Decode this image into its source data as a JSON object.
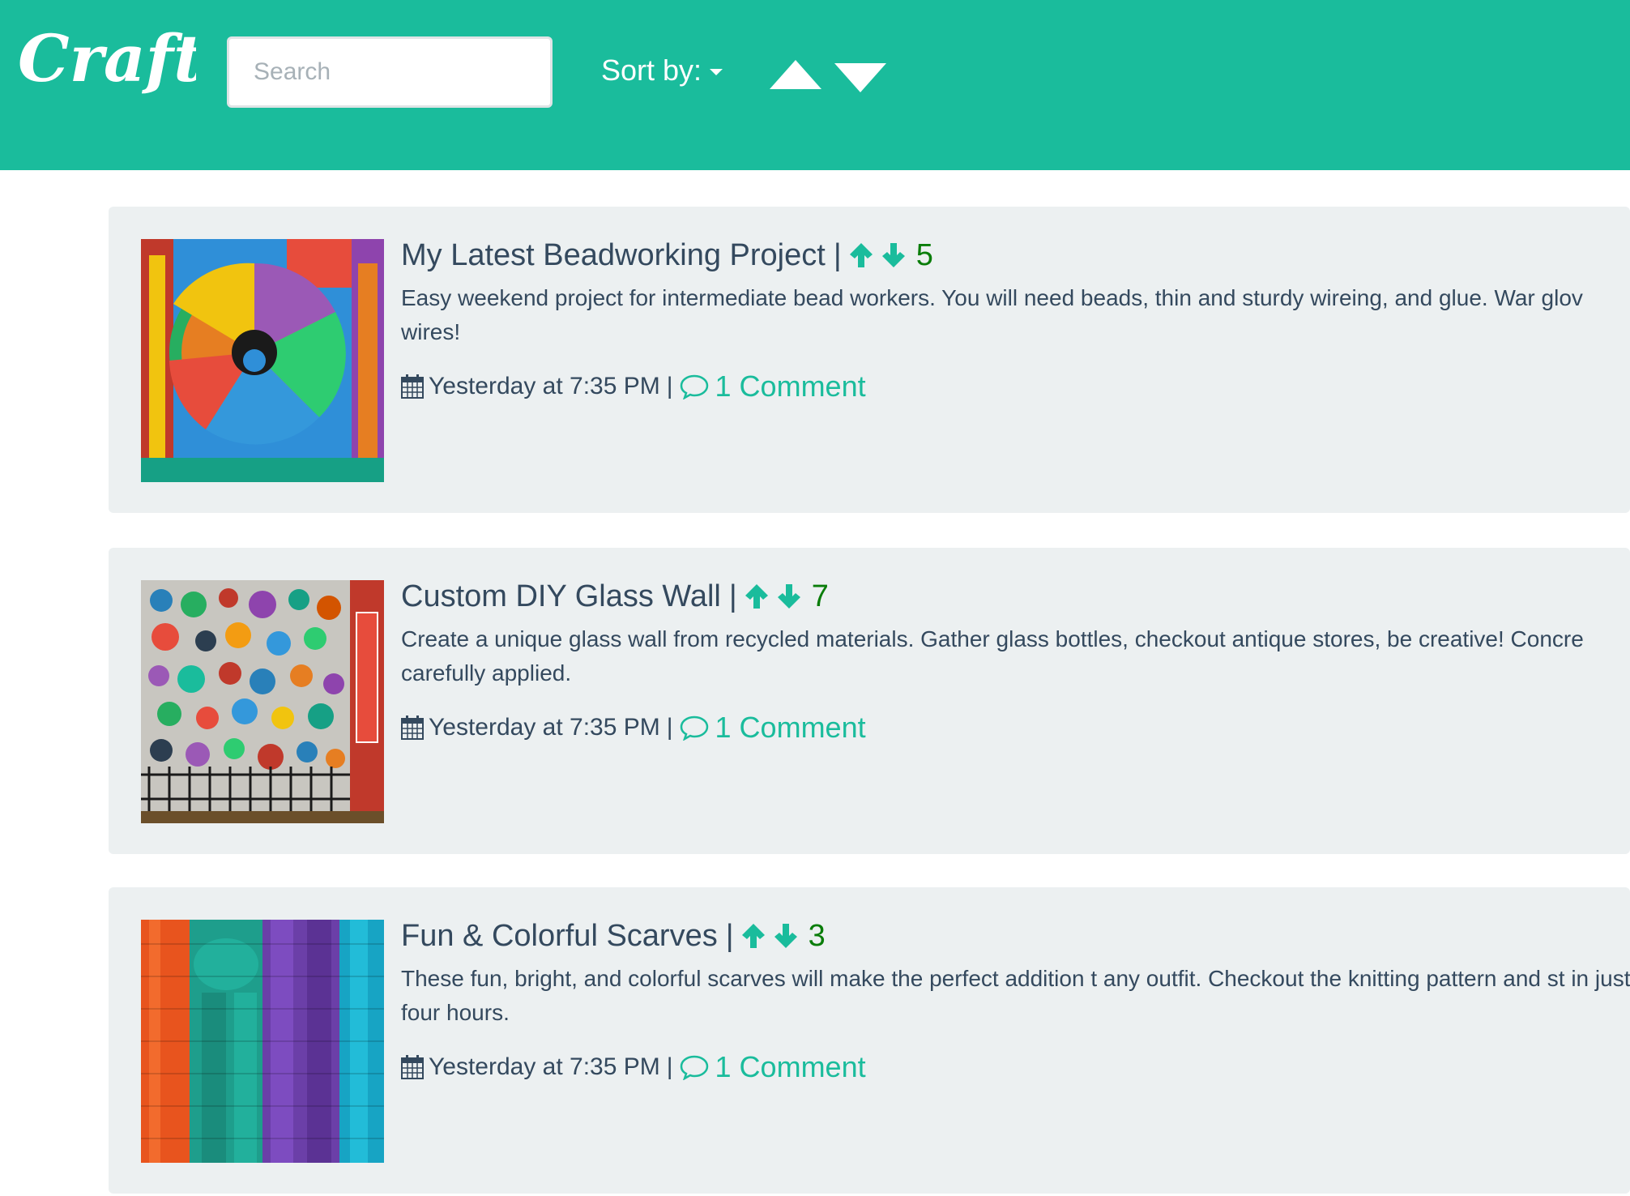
{
  "app": {
    "logo_text": "Crafty"
  },
  "colors": {
    "brand": "#1abc9c",
    "card_background": "#ecf0f1",
    "text": "#34495e",
    "score": "#0a7d0a"
  },
  "toolbar": {
    "search_placeholder": "Search",
    "sort_label": "Sort by:",
    "sort_ascending_icon": "triangle-up-icon",
    "sort_descending_icon": "triangle-down-icon"
  },
  "posts": [
    {
      "title": "My Latest Beadworking Project",
      "separator": "|",
      "score": "5",
      "description": "Easy weekend project for intermediate bead workers. You will need beads, thin and sturdy wireing, and glue. War glov wires!",
      "timestamp": "Yesterday at 7:35 PM",
      "meta_separator": "|",
      "comments": "1 Comment"
    },
    {
      "title": "Custom DIY Glass Wall",
      "separator": "|",
      "score": "7",
      "description": "Create a unique glass wall from recycled materials. Gather glass bottles, checkout antique stores, be creative! Concre carefully applied.",
      "timestamp": "Yesterday at 7:35 PM",
      "meta_separator": "|",
      "comments": "1 Comment"
    },
    {
      "title": "Fun & Colorful Scarves",
      "separator": "|",
      "score": "3",
      "description": "These fun, bright, and colorful scarves will make the perfect addition t any outfit. Checkout the knitting pattern and st in just four hours.",
      "timestamp": "Yesterday at 7:35 PM",
      "meta_separator": "|",
      "comments": "1 Comment"
    }
  ]
}
